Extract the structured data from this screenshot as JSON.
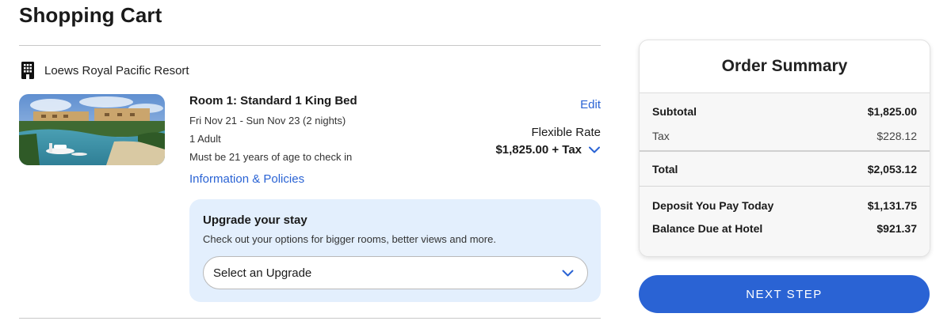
{
  "page": {
    "title": "Shopping Cart"
  },
  "hotel": {
    "icon": "hotel-building-icon",
    "name": "Loews Royal Pacific Resort"
  },
  "room": {
    "title": "Room 1: Standard 1 King Bed",
    "dates": "Fri Nov 21 - Sun Nov 23 (2 nights)",
    "guests": "1 Adult",
    "age_requirement": "Must be 21 years of age to check in",
    "info_link": "Information & Policies",
    "edit_label": "Edit",
    "rate_name": "Flexible Rate",
    "rate_price": "$1,825.00 + Tax"
  },
  "upgrade": {
    "title": "Upgrade your stay",
    "description": "Check out your options for bigger rooms, better views and more.",
    "select_label": "Select an Upgrade"
  },
  "summary": {
    "title": "Order Summary",
    "rows": [
      {
        "label": "Subtotal",
        "value": "$1,825.00"
      },
      {
        "label": "Tax",
        "value": "$228.12"
      },
      {
        "label": "Total",
        "value": "$2,053.12"
      },
      {
        "label": "Deposit You Pay Today",
        "value": "$1,131.75"
      },
      {
        "label": "Balance Due at Hotel",
        "value": "$921.37"
      }
    ]
  },
  "actions": {
    "next_step": "NEXT STEP"
  },
  "colors": {
    "accent": "#2a63d4",
    "upgrade_bg": "#e3effd"
  }
}
